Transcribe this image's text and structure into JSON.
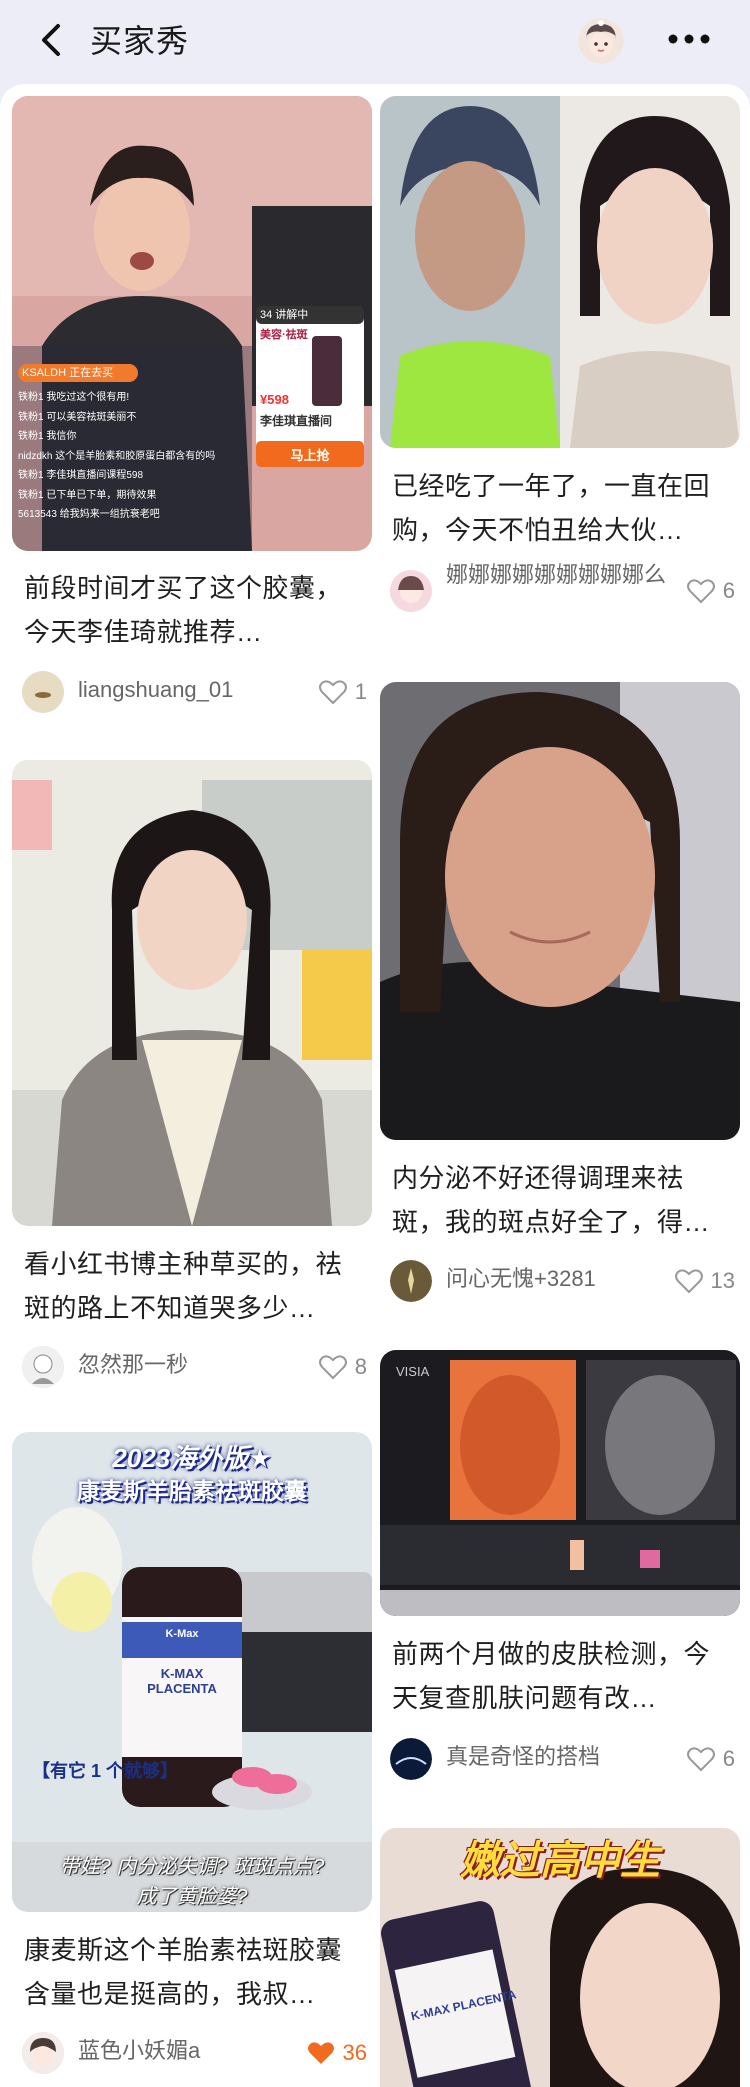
{
  "header": {
    "title": "买家秀",
    "back_icon": "chevron-left-icon",
    "more_icon": "more-dots-icon"
  },
  "feed": {
    "left": [
      {
        "image_text": {
          "badge": "34 讲解中",
          "product_title": "美容·祛斑",
          "price": "¥598",
          "buy_button": "马上抢",
          "live_label": "李佳琪直播间",
          "host_tag": "KSALDH 正在去买",
          "comments": [
            "铁粉1 我吃过这个很有用!",
            "铁粉1 可以美容祛斑美丽不",
            "铁粉1 我信你",
            "nidzdkh 这个是羊胎素和胶原蛋白都含有的吗",
            "铁粉1 李佳琪直播间课程598",
            "铁粉1 已下单已下单，期待效果",
            "5613543 给我妈来一组抗衰老吧"
          ]
        },
        "caption": "前段时间才买了这个胶囊，今天李佳琦就推荐…",
        "author": "liangshuang_01",
        "likes": "1",
        "liked": false
      },
      {
        "caption": "看小红书博主种草买的，祛斑的路上不知道哭多少…",
        "author": "忽然那一秒",
        "likes": "8",
        "liked": false
      },
      {
        "image_text": {
          "headline_1": "2023海外版★",
          "headline_2": "康麦斯羊胎素祛斑胶囊",
          "bottle_brand": "K-Max",
          "bottle_name": "K-MAX PLACENTA",
          "tag": "【有它 1 个就够】",
          "bottom_1": "带娃? 内分泌失调? 斑斑点点?",
          "bottom_2": "成了黄脸婆?"
        },
        "caption": "康麦斯这个羊胎素祛斑胶囊含量也是挺高的，我叔…",
        "author": "蓝色小妖媚a",
        "likes": "36",
        "liked": true
      }
    ],
    "right": [
      {
        "caption": "已经吃了一年了，一直在回购，今天不怕丑给大伙…",
        "author": "娜娜娜娜娜娜娜娜娜么",
        "likes": "6",
        "liked": false
      },
      {
        "caption": "内分泌不好还得调理来祛斑，我的斑点好全了，得…",
        "author": "问心无愧+3281",
        "likes": "13",
        "liked": false
      },
      {
        "image_text": {
          "brand": "VISIA"
        },
        "caption": "前两个月做的皮肤检测，今天复查肌肤问题有改…",
        "author": "真是奇怪的搭档",
        "likes": "6",
        "liked": false
      },
      {
        "image_text": {
          "headline": "嫩过高中生",
          "bottle_name": "K-MAX PLACENTA"
        }
      }
    ]
  },
  "colors": {
    "header_bg": "#ecedf7",
    "like_active": "#f06a1f",
    "like_inactive": "#999999"
  }
}
